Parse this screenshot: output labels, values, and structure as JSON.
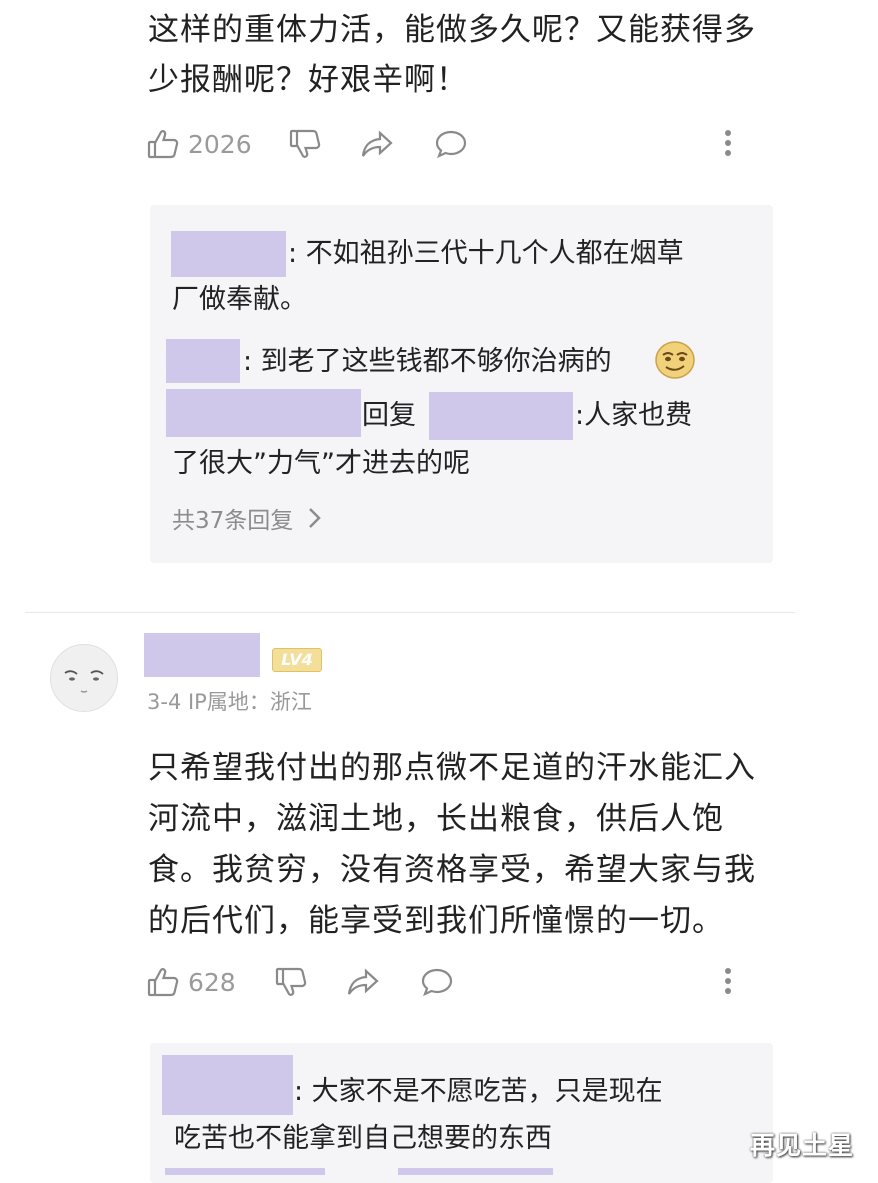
{
  "comment1": {
    "text_line1": "这样的重体力活，能做多久呢？又能获得多",
    "text_line2": "少报酬呢？好艰辛啊！",
    "like_count": "2026"
  },
  "replies1": {
    "r1_line1": ": 不如祖孙三代十几个人都在烟草",
    "r1_line2": "厂做奉献。",
    "r2_text": ": 到老了这些钱都不够你治病的",
    "r3_reply_word": "回复",
    "r3_line1_tail": ":人家也费",
    "r3_line2": "了很大”力气”才进去的呢",
    "more_replies": "共37条回复"
  },
  "comment2": {
    "level_badge": "LV4",
    "meta": "3-4  IP属地：浙江",
    "text_line1": "只希望我付出的那点微不足道的汗水能汇入",
    "text_line2": "河流中，滋润土地，长出粮食，供后人饱",
    "text_line3": "食。我贫穷，没有资格享受，希望大家与我",
    "text_line4": "的后代们，能享受到我们所憧憬的一切。",
    "like_count": "628"
  },
  "replies2": {
    "r1_line1": ": 大家不是不愿吃苦，只是现在",
    "r1_line2": "吃苦也不能拿到自己想要的东西"
  },
  "watermark": "再见土星",
  "icons": {
    "like": "thumbs-up-icon",
    "dislike": "thumbs-down-icon",
    "share": "share-icon",
    "comment": "comment-icon",
    "more": "more-vertical-icon",
    "chevron": "chevron-right-icon",
    "emoji": "smirk-emoji-icon"
  },
  "colors": {
    "redaction": "#cfc8ea",
    "reply_bg": "#f5f5f7",
    "icon_gray": "#8a8a8a",
    "badge_gold": "#e6c65a"
  }
}
